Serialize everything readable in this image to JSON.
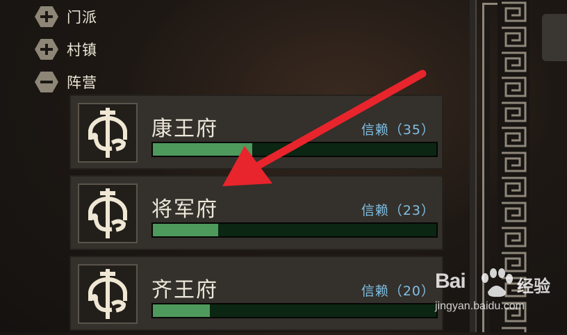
{
  "categories": [
    {
      "label": "门派",
      "state": "collapsed"
    },
    {
      "label": "村镇",
      "state": "collapsed"
    },
    {
      "label": "阵营",
      "state": "expanded"
    }
  ],
  "factions": [
    {
      "name": "康王府",
      "trust_text": "信赖（35）",
      "trust_value": 35
    },
    {
      "name": "将军府",
      "trust_text": "信赖（23）",
      "trust_value": 23
    },
    {
      "name": "齐王府",
      "trust_text": "信赖（20）",
      "trust_value": 20
    }
  ],
  "trust_max_estimate": 100,
  "colors": {
    "bar_fill": "#4e9a5c",
    "bar_empty": "#0b2612",
    "trust_text": "#7fc0e6",
    "arrow": "#e8242c"
  },
  "watermark": {
    "logo": "Bai",
    "logo_cn": "经验",
    "url": "jingyan.baidu.com"
  }
}
